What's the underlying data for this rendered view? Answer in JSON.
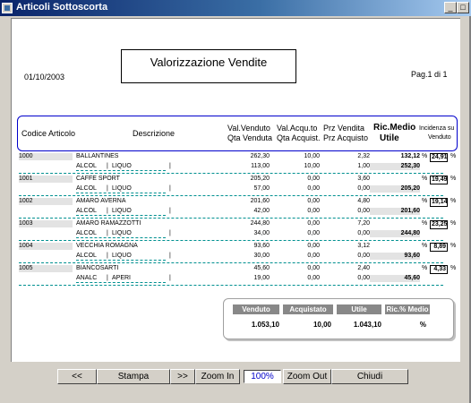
{
  "window": {
    "title": "Articoli Sottoscorta",
    "minimize_glyph": "_",
    "maximize_glyph": "□"
  },
  "report": {
    "date": "01/10/2003",
    "title": "Valorizzazione Vendite",
    "page": "Pag.1 di 1",
    "headers": {
      "codice": "Codice Articolo",
      "descrizione": "Descrizione",
      "val_venduto": "Val.Venduto",
      "qta_venduta": "Qta Venduta",
      "val_acquisto": "Val.Acqu.to",
      "qta_acquist": "Qta Acquist.",
      "prz_vendita": "Prz Vendita",
      "prz_acquisto": "Prz Acquisto",
      "ric_medio": "Ric.Medio",
      "utile": "Utile",
      "incidenza": "Incidenza su",
      "incidenza2": "Venduto"
    },
    "rows": [
      {
        "code": "1000",
        "name": "BALLANTINES",
        "cat": "ALCOL",
        "sub": "LIQUO",
        "val_venduto": "262,30",
        "val_acq": "10,00",
        "prz_vend": "2,32",
        "ric": "132,12",
        "pct": "%",
        "incid": "24,91",
        "incid_pct": "%",
        "qta_vend": "113,00",
        "qta_acq": "10,00",
        "prz_acq": "1,00",
        "utile": "252,30"
      },
      {
        "code": "1001",
        "name": "CAFFE SPORT",
        "cat": "ALCOL",
        "sub": "LIQUO",
        "val_venduto": "205,20",
        "val_acq": "0,00",
        "prz_vend": "3,60",
        "ric": "",
        "pct": "%",
        "incid": "19,49",
        "incid_pct": "%",
        "qta_vend": "57,00",
        "qta_acq": "0,00",
        "prz_acq": "0,00",
        "utile": "205,20"
      },
      {
        "code": "1002",
        "name": "AMARO AVERNA",
        "cat": "ALCOL",
        "sub": "LIQUO",
        "val_venduto": "201,60",
        "val_acq": "0,00",
        "prz_vend": "4,80",
        "ric": "",
        "pct": "%",
        "incid": "19,14",
        "incid_pct": "%",
        "qta_vend": "42,00",
        "qta_acq": "0,00",
        "prz_acq": "0,00",
        "utile": "201,60"
      },
      {
        "code": "1003",
        "name": "AMARO RAMAZZOTTI",
        "cat": "ALCOL",
        "sub": "LIQUO",
        "val_venduto": "244,80",
        "val_acq": "0,00",
        "prz_vend": "7,20",
        "ric": "",
        "pct": "%",
        "incid": "23,25",
        "incid_pct": "%",
        "qta_vend": "34,00",
        "qta_acq": "0,00",
        "prz_acq": "0,00",
        "utile": "244,80"
      },
      {
        "code": "1004",
        "name": "VECCHIA ROMAGNA",
        "cat": "ALCOL",
        "sub": "LIQUO",
        "val_venduto": "93,60",
        "val_acq": "0,00",
        "prz_vend": "3,12",
        "ric": "",
        "pct": "%",
        "incid": "8,89",
        "incid_pct": "%",
        "qta_vend": "30,00",
        "qta_acq": "0,00",
        "prz_acq": "0,00",
        "utile": "93,60"
      },
      {
        "code": "1005",
        "name": "BIANCOSARTI",
        "cat": "ANALC",
        "sub": "APERI",
        "val_venduto": "45,60",
        "val_acq": "0,00",
        "prz_vend": "2,40",
        "ric": "",
        "pct": "%",
        "incid": "4,33",
        "incid_pct": "%",
        "qta_vend": "19,00",
        "qta_acq": "0,00",
        "prz_acq": "0,00",
        "utile": "45,60"
      }
    ],
    "totals": {
      "venduto_label": "Venduto",
      "acquistato_label": "Acquistato",
      "utile_label": "Utile",
      "ric_label": "Ric.% Medio",
      "venduto": "1.053,10",
      "acquistato": "10,00",
      "utile": "1.043,10",
      "ric_pct": "%"
    }
  },
  "toolbar": {
    "first": "<<",
    "print": "Stampa",
    "next": ">>",
    "zoom_in": "Zoom In",
    "zoom_value": "100%",
    "zoom_out": "Zoom Out",
    "close": "Chiudi"
  }
}
